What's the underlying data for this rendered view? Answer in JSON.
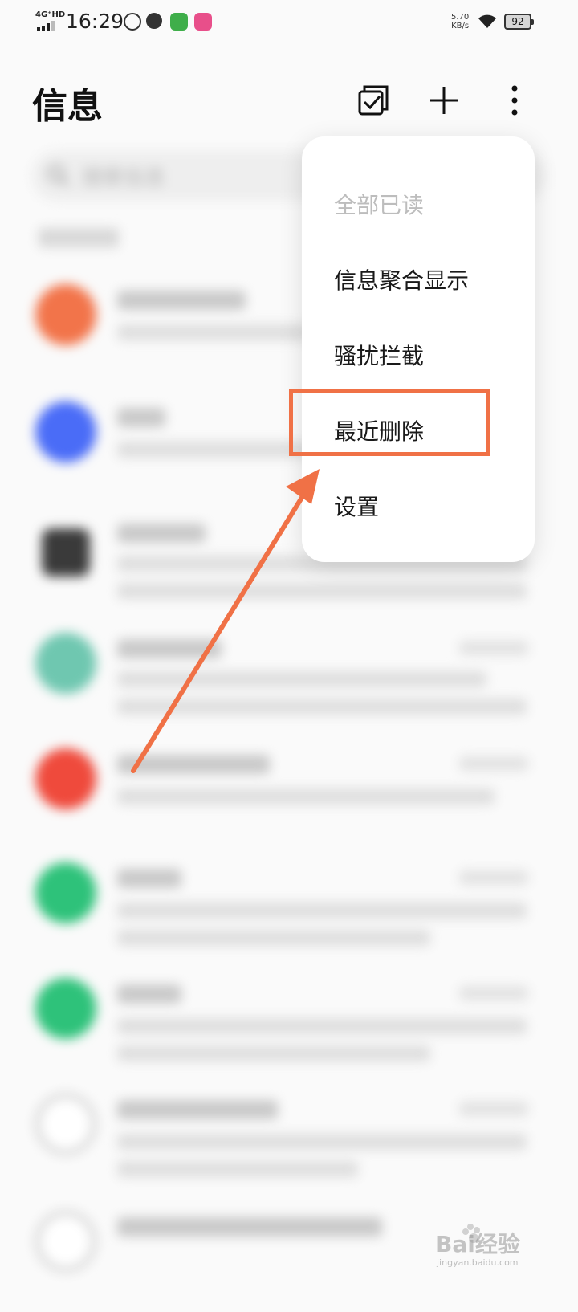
{
  "status_bar": {
    "network": "4G⁺HD",
    "time": "16:29",
    "speed_value": "5.70",
    "speed_unit": "KB/s",
    "battery": "92"
  },
  "header": {
    "title": "信息",
    "icons": [
      "select-checkbox-icon",
      "plus-icon",
      "more-vertical-icon"
    ]
  },
  "search": {
    "placeholder": "搜索信息"
  },
  "menu": {
    "items": [
      {
        "label": "全部已读",
        "enabled": false
      },
      {
        "label": "信息聚合显示",
        "enabled": true
      },
      {
        "label": "骚扰拦截",
        "enabled": true
      },
      {
        "label": "最近删除",
        "enabled": true
      },
      {
        "label": "设置",
        "enabled": true
      }
    ],
    "highlighted_index": 3
  },
  "annotation": {
    "color": "#f07146"
  },
  "watermark": {
    "text": "Bai经验",
    "sub": "jingyan.baidu.com"
  },
  "colors": {
    "avatars": [
      "#f2744a",
      "#4a6cf7",
      "#3a3a3a",
      "#6fc7b0",
      "#ef4a3c",
      "#2ec27a",
      "#2ec27a",
      "#dddddd",
      "#dddddd"
    ]
  }
}
